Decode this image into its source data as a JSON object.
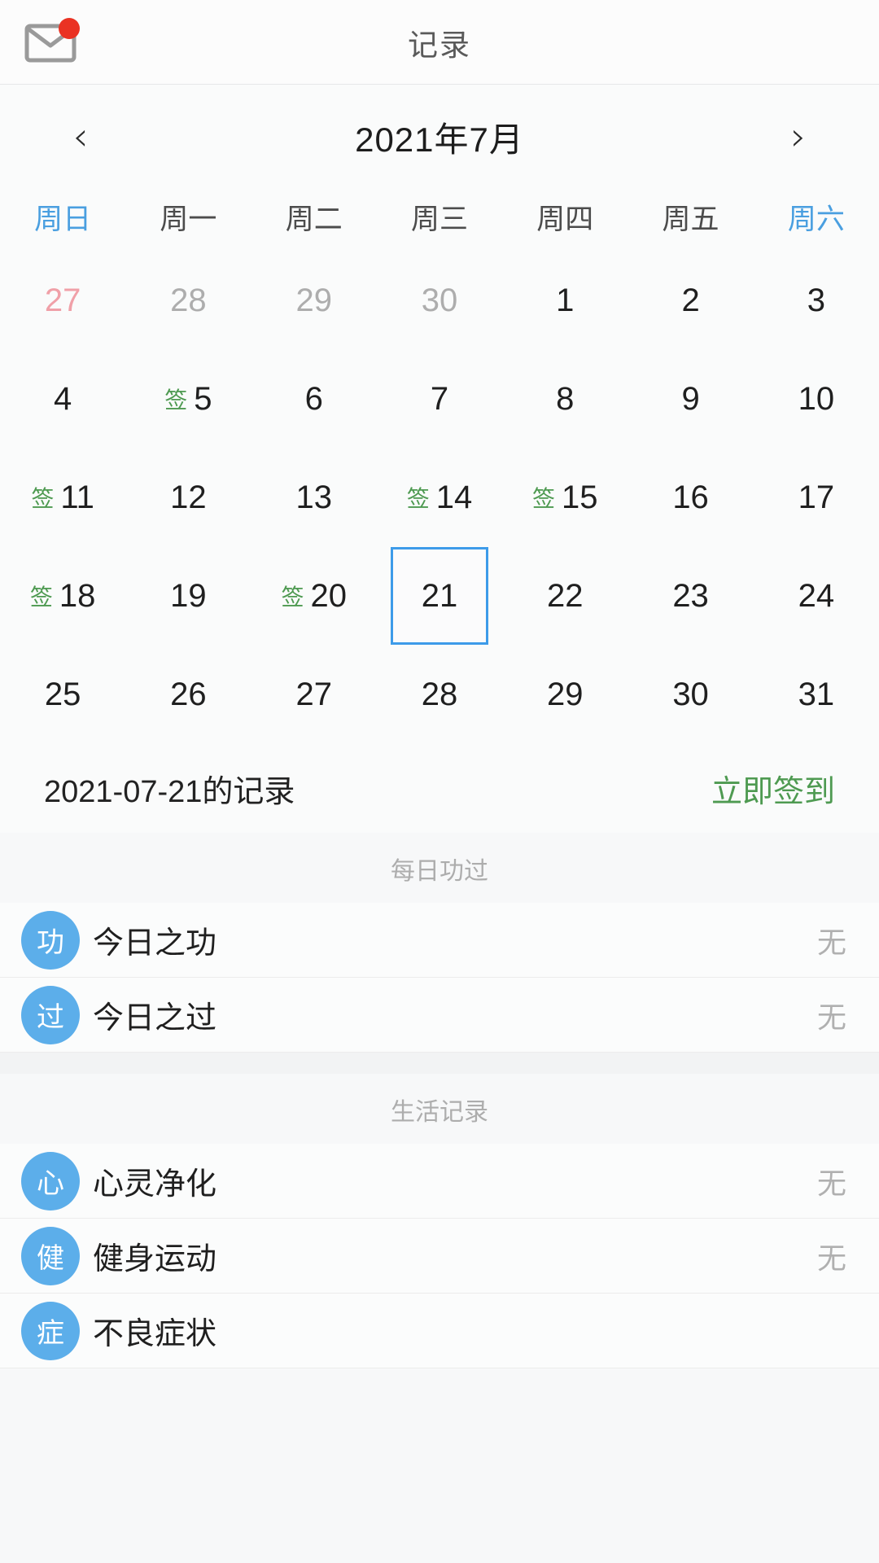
{
  "header": {
    "title": "记录",
    "mail_icon": "mail-icon",
    "badge_icon": "notification-dot"
  },
  "calendar": {
    "prev_label": "‹",
    "next_label": "›",
    "month_label": "2021年7月",
    "weekdays": [
      {
        "label": "周日",
        "weekend": true
      },
      {
        "label": "周一",
        "weekend": false
      },
      {
        "label": "周二",
        "weekend": false
      },
      {
        "label": "周三",
        "weekend": false
      },
      {
        "label": "周四",
        "weekend": false
      },
      {
        "label": "周五",
        "weekend": false
      },
      {
        "label": "周六",
        "weekend": true
      }
    ],
    "sign_mark": "签",
    "selected_day": 21,
    "days": [
      {
        "n": "27",
        "state": "other-sun",
        "sign": false
      },
      {
        "n": "28",
        "state": "other",
        "sign": false
      },
      {
        "n": "29",
        "state": "other",
        "sign": false
      },
      {
        "n": "30",
        "state": "other",
        "sign": false
      },
      {
        "n": "1",
        "state": "cur",
        "sign": false
      },
      {
        "n": "2",
        "state": "cur",
        "sign": false
      },
      {
        "n": "3",
        "state": "cur",
        "sign": false
      },
      {
        "n": "4",
        "state": "cur",
        "sign": false
      },
      {
        "n": "5",
        "state": "cur",
        "sign": true
      },
      {
        "n": "6",
        "state": "cur",
        "sign": false
      },
      {
        "n": "7",
        "state": "cur",
        "sign": false
      },
      {
        "n": "8",
        "state": "cur",
        "sign": false
      },
      {
        "n": "9",
        "state": "cur",
        "sign": false
      },
      {
        "n": "10",
        "state": "cur",
        "sign": false
      },
      {
        "n": "11",
        "state": "cur",
        "sign": true
      },
      {
        "n": "12",
        "state": "cur",
        "sign": false
      },
      {
        "n": "13",
        "state": "cur",
        "sign": false
      },
      {
        "n": "14",
        "state": "cur",
        "sign": true
      },
      {
        "n": "15",
        "state": "cur",
        "sign": true
      },
      {
        "n": "16",
        "state": "cur",
        "sign": false
      },
      {
        "n": "17",
        "state": "cur",
        "sign": false
      },
      {
        "n": "18",
        "state": "cur",
        "sign": true
      },
      {
        "n": "19",
        "state": "cur",
        "sign": false
      },
      {
        "n": "20",
        "state": "cur",
        "sign": true
      },
      {
        "n": "21",
        "state": "cur",
        "sign": false,
        "selected": true
      },
      {
        "n": "22",
        "state": "cur",
        "sign": false
      },
      {
        "n": "23",
        "state": "cur",
        "sign": false
      },
      {
        "n": "24",
        "state": "cur",
        "sign": false
      },
      {
        "n": "25",
        "state": "cur",
        "sign": false
      },
      {
        "n": "26",
        "state": "cur",
        "sign": false
      },
      {
        "n": "27",
        "state": "cur",
        "sign": false
      },
      {
        "n": "28",
        "state": "cur",
        "sign": false
      },
      {
        "n": "29",
        "state": "cur",
        "sign": false
      },
      {
        "n": "30",
        "state": "cur",
        "sign": false
      },
      {
        "n": "31",
        "state": "cur",
        "sign": false
      }
    ]
  },
  "record_head": {
    "date_label": "2021-07-21的记录",
    "action_label": "立即签到"
  },
  "sections": [
    {
      "title": "每日功过",
      "items": [
        {
          "avatar": "功",
          "label": "今日之功",
          "value": "无"
        },
        {
          "avatar": "过",
          "label": "今日之过",
          "value": "无"
        }
      ]
    },
    {
      "title": "生活记录",
      "items": [
        {
          "avatar": "心",
          "label": "心灵净化",
          "value": "无"
        },
        {
          "avatar": "健",
          "label": "健身运动",
          "value": "无"
        },
        {
          "avatar": "症",
          "label": "不良症状",
          "value": ""
        }
      ]
    }
  ],
  "colors": {
    "accent_blue": "#3d9be9",
    "weekend_blue": "#4a9fe0",
    "sign_green": "#4e9a51",
    "avatar_blue": "#5caeea",
    "badge_red": "#ea3223"
  }
}
